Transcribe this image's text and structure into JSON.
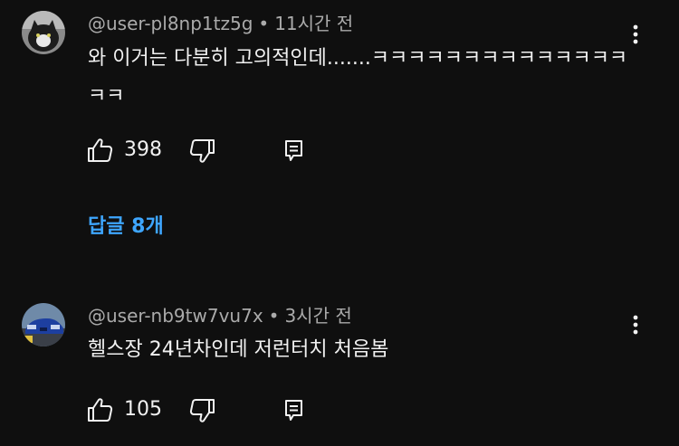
{
  "comments": [
    {
      "author": "@user-pl8np1tz5g",
      "time": "11시간 전",
      "separator": "•",
      "text": "와 이거는 다분히 고의적인데.......ㅋㅋㅋㅋㅋㅋㅋㅋㅋㅋㅋㅋㅋㅋㅋㅋ",
      "likes": "398",
      "replies_label": "답글 8개"
    },
    {
      "author": "@user-nb9tw7vu7x",
      "time": "3시간 전",
      "separator": "•",
      "text": "헬스장 24년차인데 저런터치 처음봄",
      "likes": "105"
    }
  ],
  "icons": {
    "like": "thumbs-up-icon",
    "dislike": "thumbs-down-icon",
    "reply": "reply-icon",
    "more": "more-vertical-icon"
  },
  "colors": {
    "background": "#0f0f0f",
    "text": "#f1f1f1",
    "meta": "#aaaaaa",
    "link": "#3ea6ff"
  }
}
